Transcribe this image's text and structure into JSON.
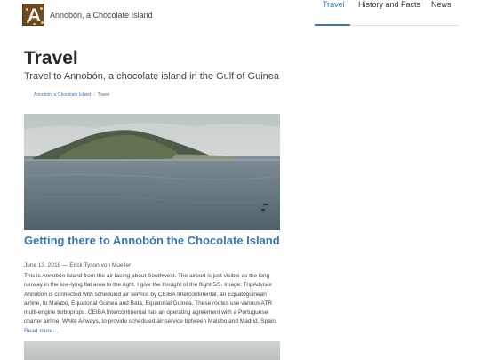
{
  "header": {
    "logo_letter": "A",
    "site_name": "Annobón, a Chocolate Island",
    "nav": [
      {
        "label": "Travel",
        "active": true
      },
      {
        "label": "History and Facts",
        "active": false
      },
      {
        "label": "News",
        "active": false
      }
    ]
  },
  "page": {
    "title": "Travel",
    "subtitle": "Travel to Annobón, a chocolate island in the Gulf of Guinea"
  },
  "breadcrumb": [
    {
      "label": "Annobón, a Chocolate Island",
      "link": true
    },
    {
      "label": "Travel",
      "link": false
    }
  ],
  "article": {
    "title": "Getting there to Annobón the Chocolate Island",
    "meta": "June 13, 2019 — Erick Tyson von Mueller",
    "excerpt": "This is Annobón Island from the air facing about Southwest. The airport is just visible as the long runway in the low-lying flat area to the right. I give the thought of the flight 5/5. Image: TripAdvisor Annobon is connected with scheduled air service by CEIBA Intercontinental, an Equatoguinean airline, to Malabo, Equatorial Guinea and Bata, Equatorial Guinea. These routes use various ATR multi-engine turboprops. CEIBA Intercontinental has an operating agreement with a Portuguese charter airline, White Airways, to provide scheduled air service between Malabo and Madrid, Spain.",
    "read_more": "Read more…"
  },
  "colors": {
    "link": "#3a76b5",
    "logo_bg": "#6b4a22"
  }
}
